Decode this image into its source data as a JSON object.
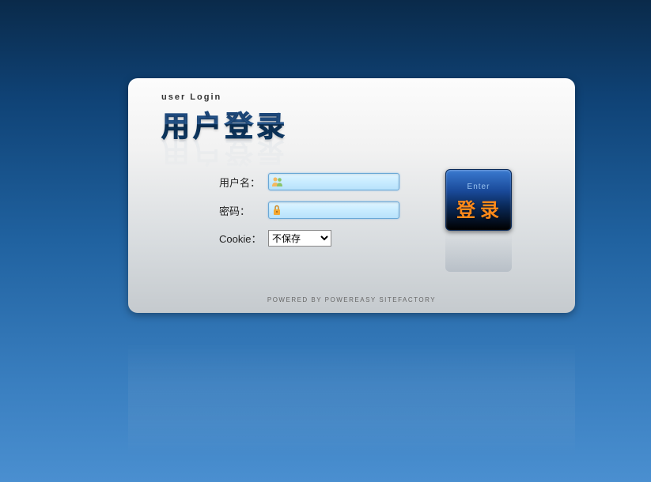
{
  "header": {
    "subtitle": "user Login",
    "title": "用户登录"
  },
  "form": {
    "username_label": "用户名：",
    "password_label": "密码：",
    "cookie_label": "Cookie：",
    "cookie_selected": "不保存"
  },
  "submit": {
    "sub_label": "Enter",
    "main_label": "登录"
  },
  "footer": {
    "text": "POWERED BY POWEREASY SITEFACTORY"
  },
  "colors": {
    "accent_blue": "#1a5a9a",
    "button_orange": "#ff8a1a",
    "bg_gradient_top": "#0a2a4a",
    "bg_gradient_bottom": "#4a8fd0"
  }
}
